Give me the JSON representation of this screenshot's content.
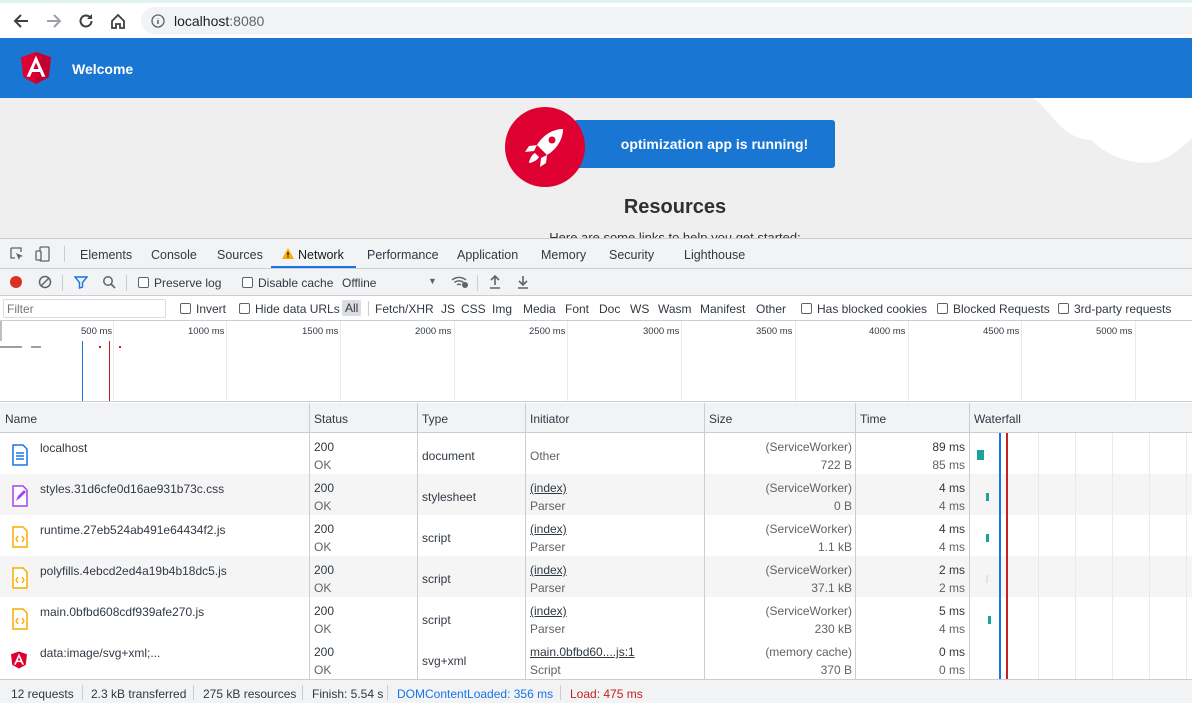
{
  "browser": {
    "url_host": "localhost",
    "url_port": ":8080"
  },
  "app": {
    "title": "Welcome",
    "running_text": "optimization app is running!",
    "resources_heading": "Resources",
    "resources_sub": "Here are some links to help you get started:",
    "colors": {
      "header": "#1976d2",
      "accent": "#dd0031"
    }
  },
  "devtools": {
    "tabs": [
      {
        "label": "Elements"
      },
      {
        "label": "Console"
      },
      {
        "label": "Sources"
      },
      {
        "label": "Network"
      },
      {
        "label": "Performance"
      },
      {
        "label": "Application"
      },
      {
        "label": "Memory"
      },
      {
        "label": "Security"
      },
      {
        "label": "Lighthouse"
      }
    ],
    "toolbar": {
      "preserve_log": "Preserve log",
      "disable_cache": "Disable cache",
      "throttling": "Offline"
    },
    "filter": {
      "placeholder": "Filter",
      "invert": "Invert",
      "hide_data_urls": "Hide data URLs",
      "types": [
        "All",
        "Fetch/XHR",
        "JS",
        "CSS",
        "Img",
        "Media",
        "Font",
        "Doc",
        "WS",
        "Wasm",
        "Manifest",
        "Other"
      ],
      "has_blocked_cookies": "Has blocked cookies",
      "blocked_requests": "Blocked Requests",
      "third_party": "3rd-party requests"
    },
    "overview_ticks": [
      "500 ms",
      "1000 ms",
      "1500 ms",
      "2000 ms",
      "2500 ms",
      "3000 ms",
      "3500 ms",
      "4000 ms",
      "4500 ms",
      "5000 ms"
    ],
    "columns": {
      "name": "Name",
      "status": "Status",
      "type": "Type",
      "initiator": "Initiator",
      "size": "Size",
      "time": "Time",
      "waterfall": "Waterfall"
    },
    "rows": [
      {
        "name": "localhost",
        "icon": "document-icon",
        "status": "200",
        "status_text": "OK",
        "type": "document",
        "initiator": "Other",
        "initiator_sub": "",
        "size": "(ServiceWorker)",
        "size_sub": "722 B",
        "time": "89 ms",
        "time_sub": "85 ms"
      },
      {
        "name": "styles.31d6cfe0d16ae931b73c.css",
        "icon": "stylesheet-icon",
        "status": "200",
        "status_text": "OK",
        "type": "stylesheet",
        "initiator": "(index)",
        "initiator_sub": "Parser",
        "size": "(ServiceWorker)",
        "size_sub": "0 B",
        "time": "4 ms",
        "time_sub": "4 ms"
      },
      {
        "name": "runtime.27eb524ab491e64434f2.js",
        "icon": "script-icon",
        "status": "200",
        "status_text": "OK",
        "type": "script",
        "initiator": "(index)",
        "initiator_sub": "Parser",
        "size": "(ServiceWorker)",
        "size_sub": "1.1 kB",
        "time": "4 ms",
        "time_sub": "4 ms"
      },
      {
        "name": "polyfills.4ebcd2ed4a19b4b18dc5.js",
        "icon": "script-icon",
        "status": "200",
        "status_text": "OK",
        "type": "script",
        "initiator": "(index)",
        "initiator_sub": "Parser",
        "size": "(ServiceWorker)",
        "size_sub": "37.1 kB",
        "time": "2 ms",
        "time_sub": "2 ms"
      },
      {
        "name": "main.0bfbd608cdf939afe270.js",
        "icon": "script-icon",
        "status": "200",
        "status_text": "OK",
        "type": "script",
        "initiator": "(index)",
        "initiator_sub": "Parser",
        "size": "(ServiceWorker)",
        "size_sub": "230 kB",
        "time": "5 ms",
        "time_sub": "4 ms"
      },
      {
        "name": "data:image/svg+xml;...",
        "icon": "angular-icon",
        "status": "200",
        "status_text": "OK",
        "type": "svg+xml",
        "initiator": "main.0bfbd60....js:1",
        "initiator_sub": "Script",
        "size": "(memory cache)",
        "size_sub": "370 B",
        "time": "0 ms",
        "time_sub": "0 ms"
      }
    ],
    "status_bar": {
      "requests": "12 requests",
      "transferred": "2.3 kB transferred",
      "resources": "275 kB resources",
      "finish": "Finish: 5.54 s",
      "dom_content_loaded": "DOMContentLoaded: 356 ms",
      "load": "Load: 475 ms",
      "dcl_color": "#1a73e8",
      "load_color": "#c5221f"
    }
  }
}
